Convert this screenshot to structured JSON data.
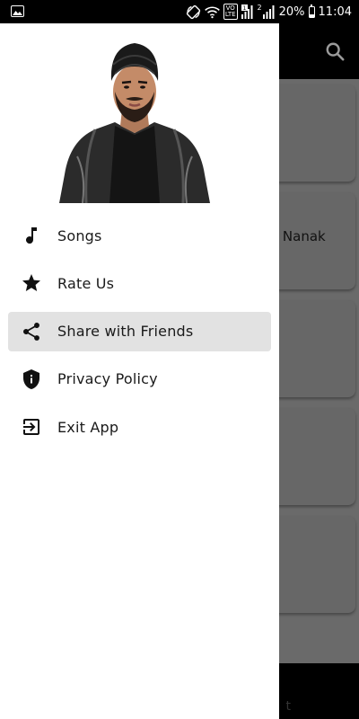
{
  "status_bar": {
    "volte_top": "VO",
    "volte_bottom": "LTE",
    "sim_number": "2",
    "sim_badge": "1",
    "battery_percent": "20%",
    "time": "11:04"
  },
  "background_app": {
    "card_title": "r Nanak",
    "bottom_text": "t"
  },
  "drawer": {
    "menu": [
      {
        "label": "Songs",
        "icon": "music-note-icon",
        "active": false
      },
      {
        "label": "Rate Us",
        "icon": "star-icon",
        "active": false
      },
      {
        "label": "Share with Friends",
        "icon": "share-icon",
        "active": true
      },
      {
        "label": "Privacy Policy",
        "icon": "shield-icon",
        "active": false
      },
      {
        "label": "Exit App",
        "icon": "exit-icon",
        "active": false
      }
    ]
  },
  "colors": {
    "drawer_bg": "#ffffff",
    "active_item_bg": "#e2e2e2",
    "scrim": "#6a6a6a",
    "toolbar": "#000000"
  }
}
